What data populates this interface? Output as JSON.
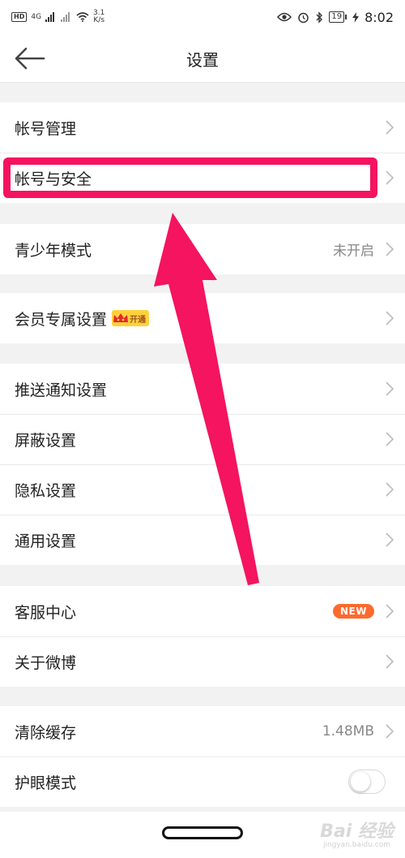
{
  "status_bar": {
    "network_badge": "HD",
    "signal_label": "4G",
    "speed_value": "3.1",
    "speed_unit": "K/s",
    "battery": "19",
    "time": "8:02"
  },
  "nav": {
    "title": "设置"
  },
  "groups": [
    {
      "rows": [
        {
          "label": "帐号管理"
        },
        {
          "label": "帐号与安全"
        }
      ]
    },
    {
      "rows": [
        {
          "label": "青少年模式",
          "value": "未开启"
        }
      ]
    },
    {
      "rows": [
        {
          "label": "会员专属设置",
          "badge": "开通"
        }
      ]
    },
    {
      "rows": [
        {
          "label": "推送通知设置"
        },
        {
          "label": "屏蔽设置"
        },
        {
          "label": "隐私设置"
        },
        {
          "label": "通用设置"
        }
      ]
    },
    {
      "rows": [
        {
          "label": "客服中心",
          "badge": "NEW"
        },
        {
          "label": "关于微博"
        }
      ]
    },
    {
      "rows": [
        {
          "label": "清除缓存",
          "value": "1.48MB"
        },
        {
          "label": "护眼模式",
          "toggle": false
        }
      ]
    }
  ],
  "watermark": {
    "brand": "Bai 经验",
    "url": "jingyan.baidu.com"
  },
  "colors": {
    "highlight": "#f4145f",
    "new_badge": "#ff6a2e",
    "vip_badge": "#ffd23c"
  }
}
